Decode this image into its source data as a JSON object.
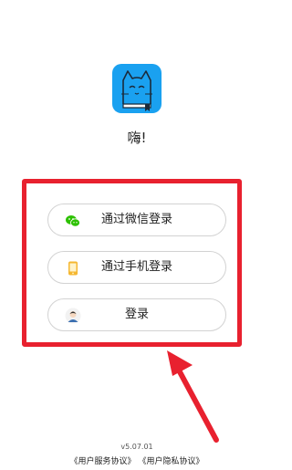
{
  "app": {
    "logo_icon": "cat-book-logo-icon",
    "greeting": "嗨!"
  },
  "login_options": {
    "wechat": {
      "label": "通过微信登录",
      "icon": "wechat-icon",
      "color": "#2dc100"
    },
    "phone": {
      "label": "通过手机登录",
      "icon": "phone-icon",
      "color": "#f5b731"
    },
    "account": {
      "label": "登录",
      "icon": "avatar-icon"
    }
  },
  "annotation": {
    "box_color": "#e8212f",
    "arrow_color": "#e8212f"
  },
  "footer": {
    "version": "v5.07.01",
    "user_agreement": "《用户服务协议》",
    "privacy_agreement": "《用户隐私协议》"
  }
}
